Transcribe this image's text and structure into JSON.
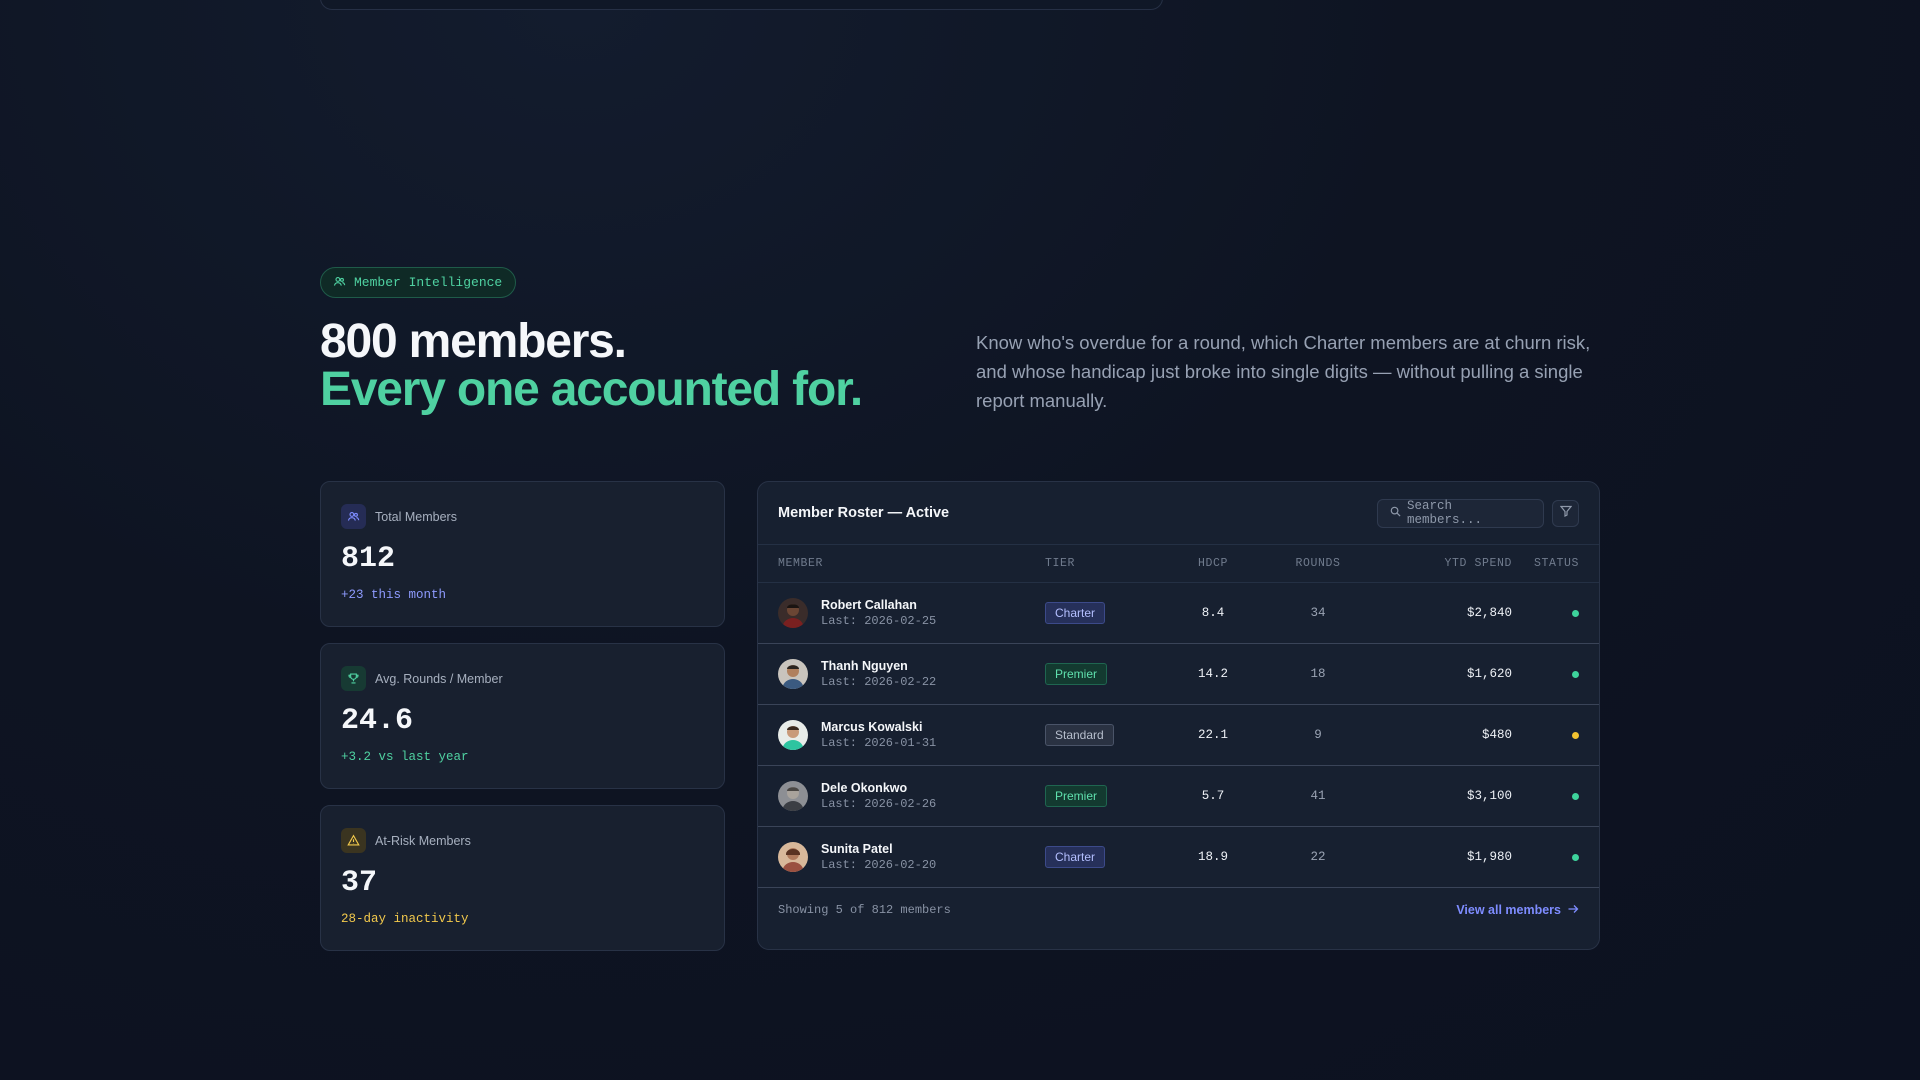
{
  "badge": {
    "label": "Member Intelligence",
    "icon": "users-icon"
  },
  "hero": {
    "title_line1": "800 members.",
    "title_line2": "Every one accounted for.",
    "description": "Know who's overdue for a round, which Charter members are at churn risk, and whose handicap just broke into single digits — without pulling a single report manually."
  },
  "stats": [
    {
      "label": "Total Members",
      "value": "812",
      "sub": "+23 this month",
      "icon": "users-icon",
      "accent": "#7e8cff"
    },
    {
      "label": "Avg. Rounds / Member",
      "value": "24.6",
      "sub": "+3.2 vs last year",
      "icon": "trophy-icon",
      "accent": "#4fd1a1"
    },
    {
      "label": "At-Risk Members",
      "value": "37",
      "sub": "28-day inactivity",
      "icon": "warning-icon",
      "accent": "#f2c94c"
    }
  ],
  "roster": {
    "title": "Member Roster — Active",
    "search_placeholder": "Search members...",
    "columns": {
      "member": "MEMBER",
      "tier": "TIER",
      "hdcp": "HDCP",
      "rounds": "ROUNDS",
      "ytd": "YTD SPEND",
      "status": "STATUS"
    },
    "rows": [
      {
        "name": "Robert Callahan",
        "last": "Last: 2026-02-25",
        "tier": "Charter",
        "hdcp": "8.4",
        "rounds": "34",
        "ytd": "$2,840",
        "status_color": "#3ed39c"
      },
      {
        "name": "Thanh Nguyen",
        "last": "Last: 2026-02-22",
        "tier": "Premier",
        "hdcp": "14.2",
        "rounds": "18",
        "ytd": "$1,620",
        "status_color": "#3ed39c"
      },
      {
        "name": "Marcus Kowalski",
        "last": "Last: 2026-01-31",
        "tier": "Standard",
        "hdcp": "22.1",
        "rounds": "9",
        "ytd": "$480",
        "status_color": "#f2c230"
      },
      {
        "name": "Dele Okonkwo",
        "last": "Last: 2026-02-26",
        "tier": "Premier",
        "hdcp": "5.7",
        "rounds": "41",
        "ytd": "$3,100",
        "status_color": "#3ed39c"
      },
      {
        "name": "Sunita Patel",
        "last": "Last: 2026-02-20",
        "tier": "Charter",
        "hdcp": "18.9",
        "rounds": "22",
        "ytd": "$1,980",
        "status_color": "#3ed39c"
      }
    ],
    "footer_count": "Showing 5 of 812 members",
    "view_all": "View all members"
  }
}
